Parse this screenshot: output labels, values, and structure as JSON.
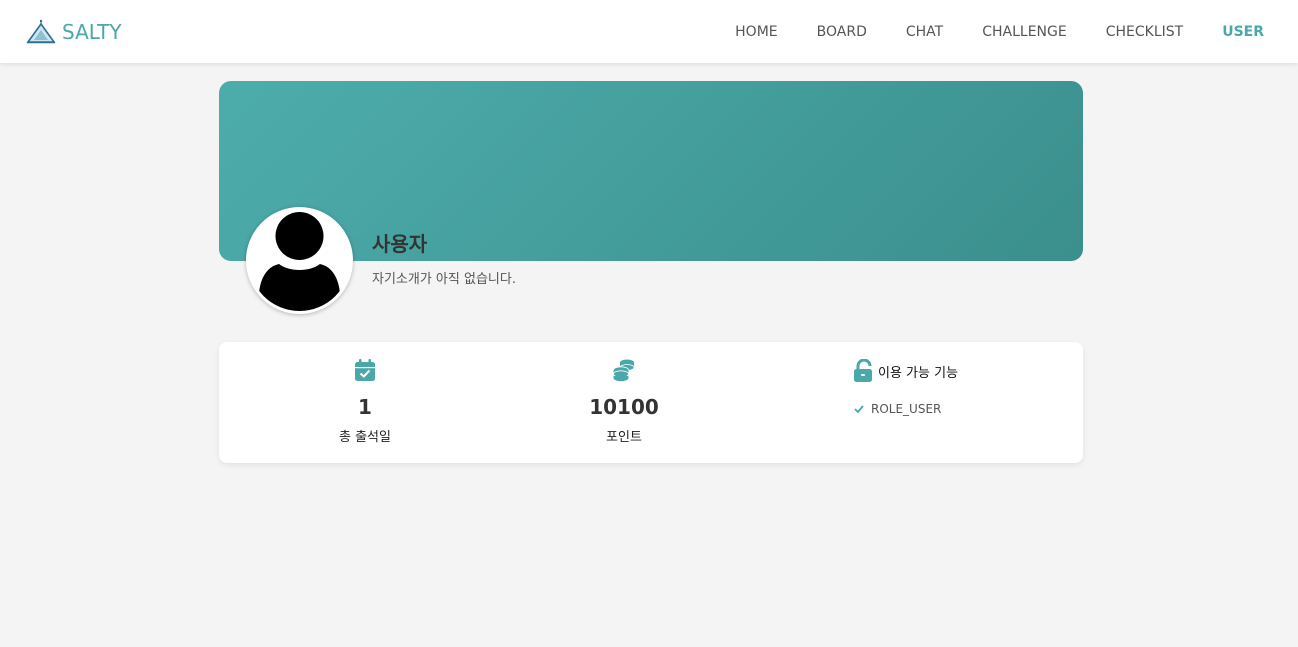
{
  "brand": {
    "name": "SALTY",
    "accent": "#4aa8a8"
  },
  "nav": {
    "items": [
      {
        "label": "HOME"
      },
      {
        "label": "BOARD"
      },
      {
        "label": "CHAT"
      },
      {
        "label": "CHALLENGE"
      },
      {
        "label": "CHECKLIST"
      },
      {
        "label": "USER",
        "active": true
      }
    ]
  },
  "profile": {
    "name": "사용자",
    "bio": "자기소개가 아직 없습니다.",
    "avatar_icon": "user-silhouette-icon"
  },
  "stats": {
    "attendance": {
      "value": "1",
      "label": "총 출석일",
      "icon": "calendar-check-icon"
    },
    "points": {
      "value": "10100",
      "label": "포인트",
      "icon": "coins-icon"
    }
  },
  "features": {
    "title": "이용 가능 기능",
    "icon": "unlock-icon",
    "items": [
      {
        "label": "ROLE_USER",
        "icon": "check-icon"
      }
    ]
  },
  "colors": {
    "banner_start": "#4dadab",
    "banner_end": "#3b8f8d",
    "background": "#f4f4f4"
  }
}
